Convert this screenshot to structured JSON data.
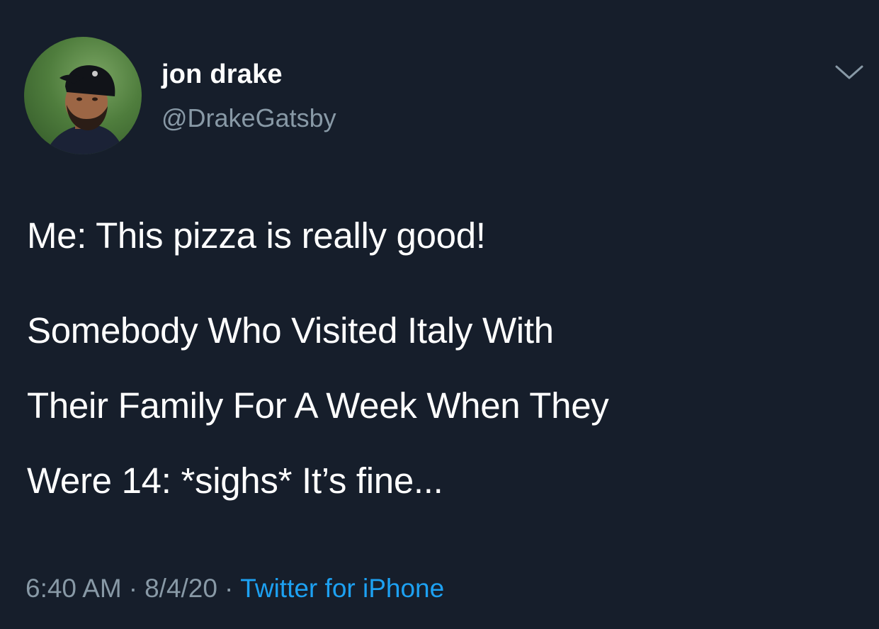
{
  "tweet": {
    "author": {
      "display_name": "jon drake",
      "handle": "@DrakeGatsby",
      "avatar_icon": "profile-photo"
    },
    "menu_icon": "chevron-down-icon",
    "text_lines": [
      "Me: This pizza is really good!",
      "Somebody Who Visited Italy With",
      "Their Family For A Week When They",
      "Were 14: *sighs* It’s fine..."
    ],
    "time": "6:40 AM",
    "date": "8/4/20",
    "separator": "·",
    "source": "Twitter for iPhone"
  },
  "colors": {
    "background": "#161e2b",
    "secondary_text": "#8899a6",
    "link": "#1da1f2"
  }
}
